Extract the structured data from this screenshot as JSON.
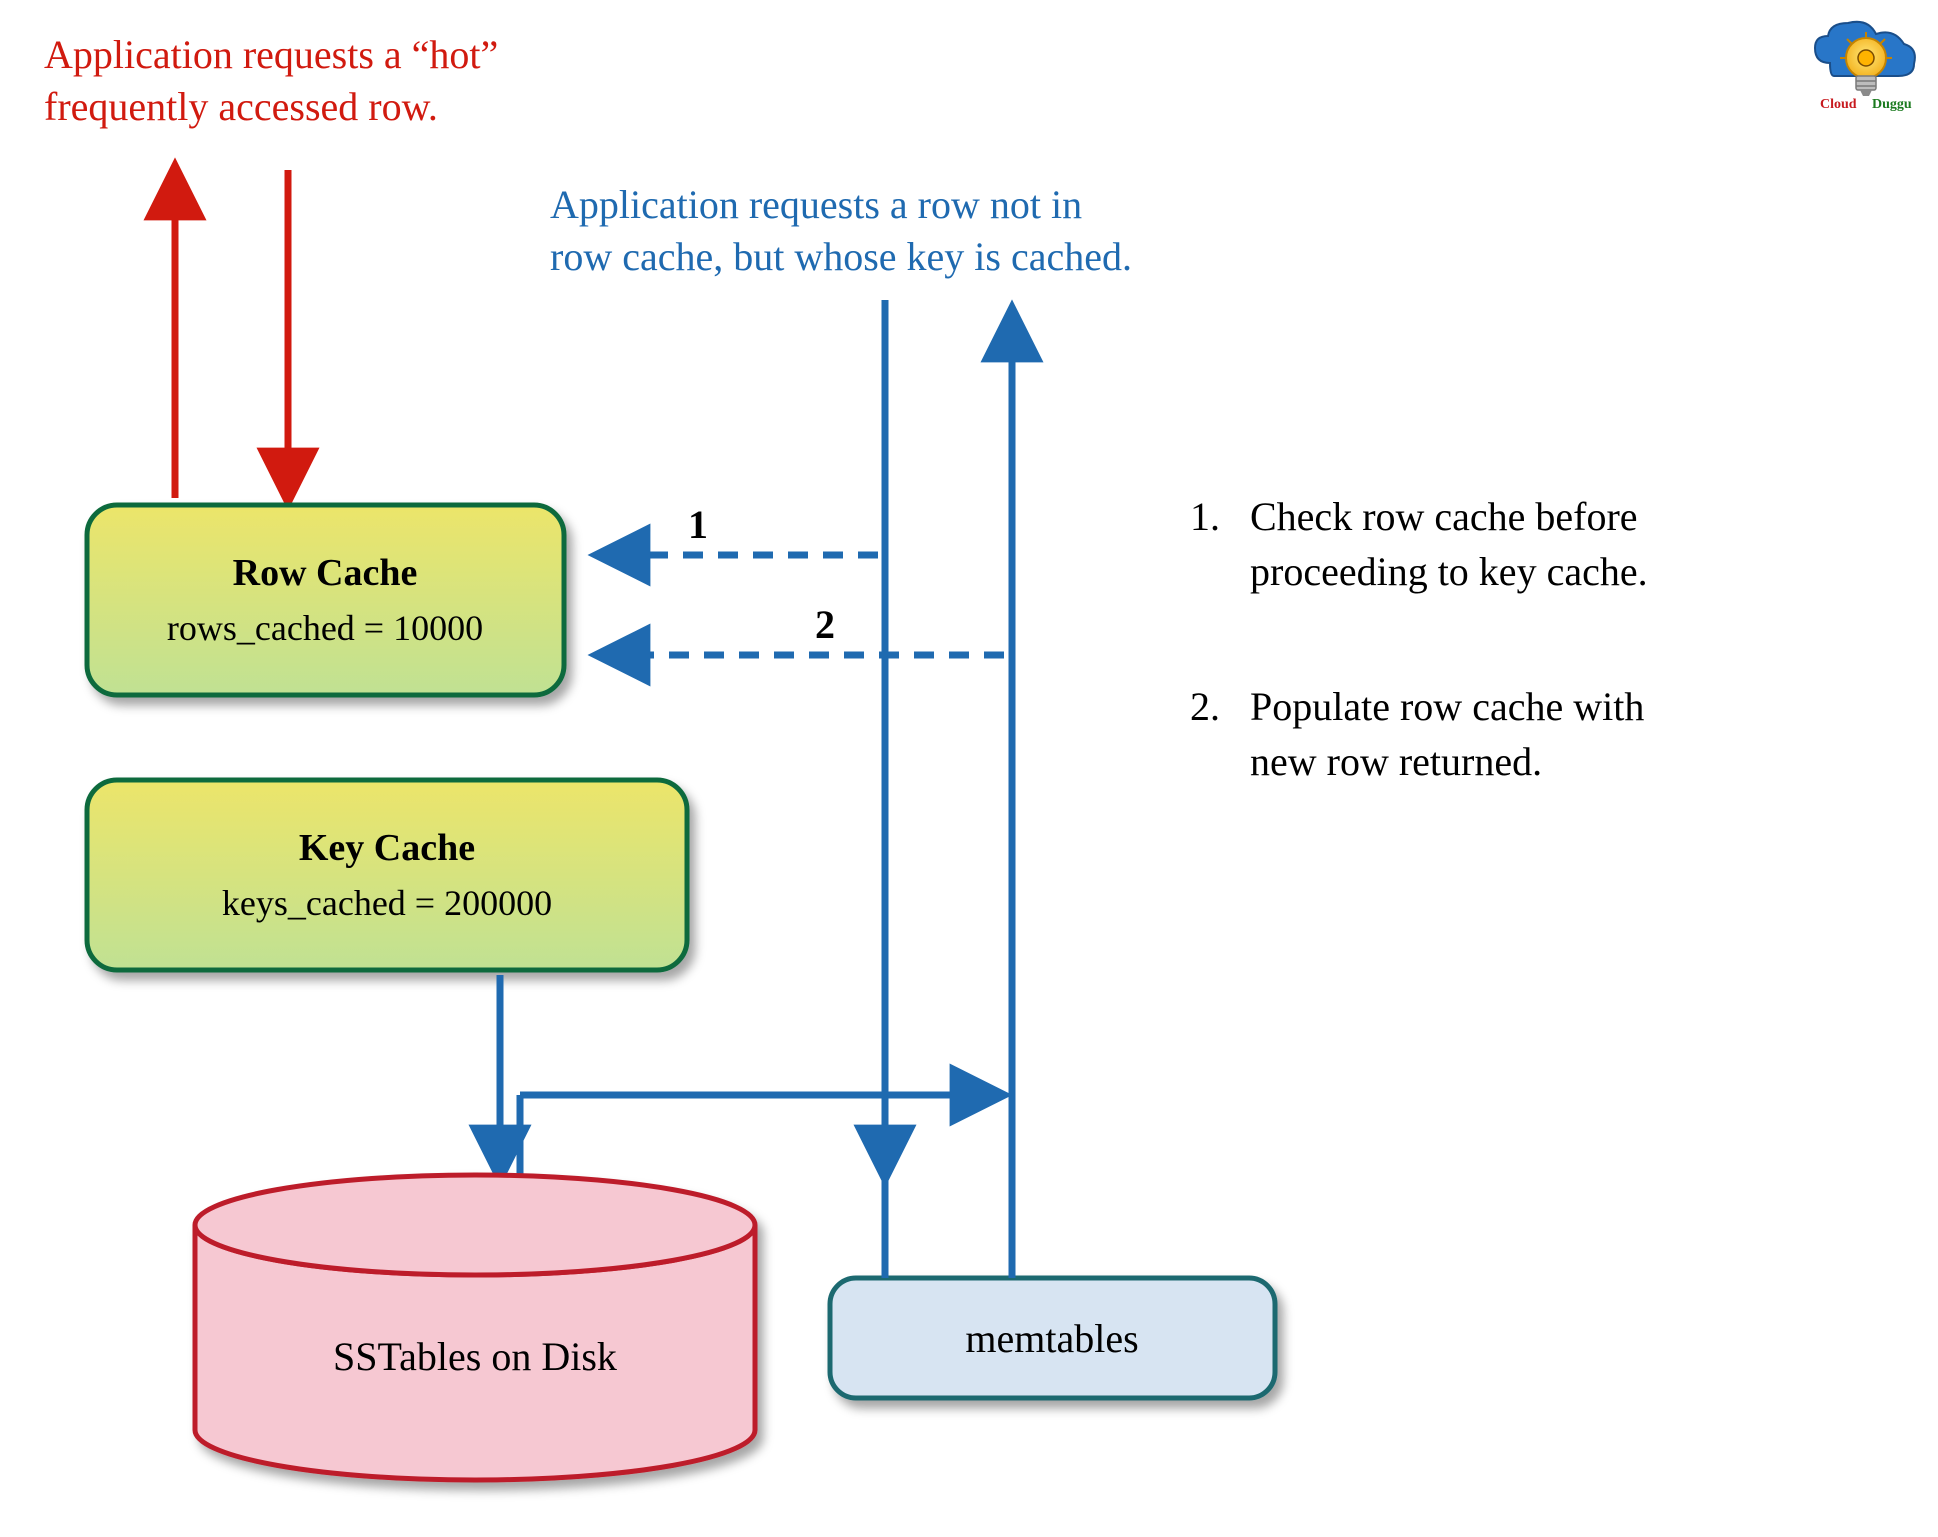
{
  "annotations": {
    "hot_row_line1": "Application requests a “hot”",
    "hot_row_line2": "frequently accessed row.",
    "not_in_cache_line1": "Application requests a row not in",
    "not_in_cache_line2": "row cache, but whose key is cached."
  },
  "boxes": {
    "row_cache": {
      "title": "Row Cache",
      "sub": "rows_cached = 10000"
    },
    "key_cache": {
      "title": "Key Cache",
      "sub": "keys_cached = 200000"
    },
    "sstables": "SSTables on Disk",
    "memtables": "memtables"
  },
  "edge_labels": {
    "one": "1",
    "two": "2"
  },
  "steps": {
    "s1_num": "1.",
    "s1_line1": "Check row cache before",
    "s1_line2": "proceeding to key cache.",
    "s2_num": "2.",
    "s2_line1": "Populate row cache with",
    "s2_line2": "new row returned."
  },
  "logo": {
    "left": "Cloud",
    "right": "Duggu"
  },
  "colors": {
    "red": "#d11a0f",
    "blue": "#1f6ab0",
    "box_stroke": "#0b6b3c",
    "memtable_stroke": "#1a6970",
    "memtable_fill": "#d7e4f2",
    "cylinder_fill": "#f6c8d2",
    "cylinder_stroke": "#bd1d2a"
  }
}
